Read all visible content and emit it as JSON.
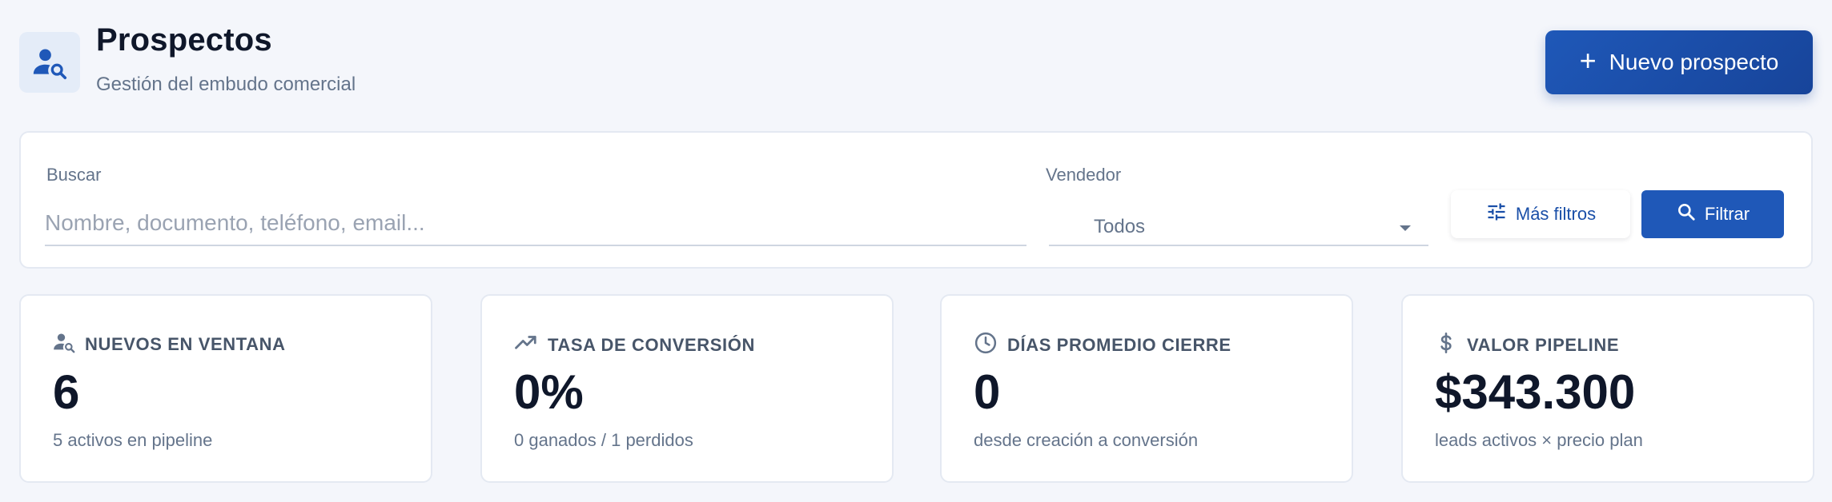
{
  "header": {
    "icon": "user-search-icon",
    "title": "Prospectos",
    "subtitle": "Gestión del embudo comercial",
    "new_button": {
      "icon": "plus-icon",
      "label": "Nuevo prospecto"
    },
    "accent_color": "#1f58b8"
  },
  "filters": {
    "search": {
      "label": "Buscar",
      "placeholder": "Nombre, documento, teléfono, email...",
      "value": ""
    },
    "seller": {
      "label": "Vendedor",
      "value": "Todos"
    },
    "more_button": {
      "icon": "tune-icon",
      "label": "Más filtros"
    },
    "filter_button": {
      "icon": "search-icon",
      "label": "Filtrar"
    }
  },
  "kpis": [
    {
      "icon": "user-search-icon",
      "title": "NUEVOS EN VENTANA",
      "value": "6",
      "sub": "5 activos en pipeline"
    },
    {
      "icon": "trending-up-icon",
      "title": "TASA DE CONVERSIÓN",
      "value": "0%",
      "sub": "0 ganados / 1 perdidos"
    },
    {
      "icon": "clock-icon",
      "title": "DÍAS PROMEDIO CIERRE",
      "value": "0",
      "sub": "desde creación a conversión"
    },
    {
      "icon": "dollar-icon",
      "title": "VALOR PIPELINE",
      "value": "$343.300",
      "sub": "leads activos × precio plan"
    }
  ]
}
